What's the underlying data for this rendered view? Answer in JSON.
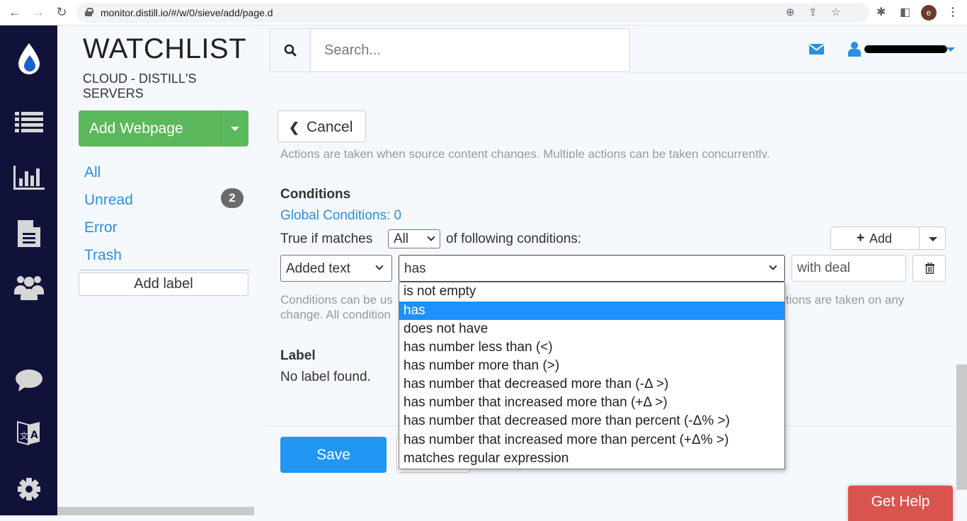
{
  "browser": {
    "url": "monitor.distill.io/#/w/0/sieve/add/page.d",
    "profile_initial": "e"
  },
  "rail": {
    "items": [
      "app-logo",
      "list",
      "reports",
      "documents",
      "team",
      "chat",
      "translate",
      "settings"
    ]
  },
  "sidebar": {
    "title": "WATCHLIST",
    "subtitle": "CLOUD - DISTILL'S SERVERS",
    "add_button": "Add Webpage",
    "items": [
      {
        "label": "All"
      },
      {
        "label": "Unread",
        "badge": "2"
      },
      {
        "label": "Error"
      },
      {
        "label": "Trash"
      }
    ],
    "add_label": "Add label"
  },
  "header": {
    "search_placeholder": "Search...",
    "username": "[redacted]"
  },
  "main": {
    "cancel_label": "Cancel",
    "actions_help": "Actions are taken when source content changes. Multiple actions can be taken concurrently.",
    "conditions": {
      "heading": "Conditions",
      "global_link": "Global Conditions: 0",
      "true_if": "True if matches",
      "match_mode": "All",
      "following": "of following conditions:",
      "add_label": "Add",
      "field": "Added text",
      "operator": "has",
      "value": "with deal",
      "help_line1_start": "Conditions can be us",
      "help_line1_end": "tions are taken on any",
      "help_line2_start": "change. All condition",
      "operator_options": [
        "is not empty",
        "has",
        "does not have",
        "has number less than (<)",
        "has number more than (>)",
        "has number that decreased more than (-Δ >)",
        "has number that increased more than (+Δ >)",
        "has number that decreased more than percent (-Δ% >)",
        "has number that increased more than percent (+Δ% >)",
        "matches regular expression"
      ],
      "selected_index": 1
    },
    "label_section": {
      "heading": "Label",
      "empty_text": "No label found."
    },
    "save_label": "Save"
  },
  "help_button": "Get Help",
  "colors": {
    "rail_bg": "#11123a",
    "accent_blue": "#2b8fde",
    "success_green": "#5cb85c",
    "primary_blue": "#2196f3",
    "danger_red": "#d9534f",
    "highlight": "#1e90ff"
  }
}
